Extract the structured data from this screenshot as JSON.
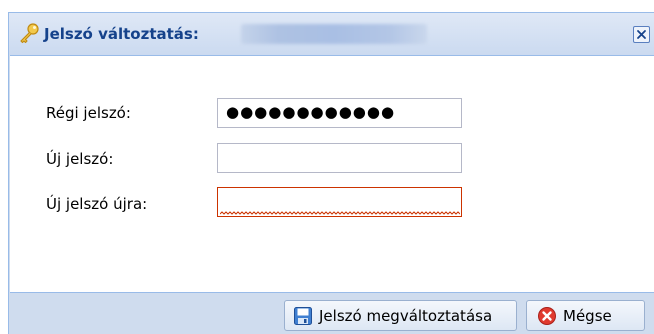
{
  "dialog": {
    "title": "Jelszó változtatás:",
    "icon": "key-icon",
    "close_icon": "close-icon"
  },
  "form": {
    "fields": [
      {
        "label": "Régi jelszó:",
        "value": "●●●●●●●●●●●●",
        "state": "filled"
      },
      {
        "label": "Új jelszó:",
        "value": "",
        "state": "empty"
      },
      {
        "label": "Új jelszó újra:",
        "value": "",
        "state": "invalid"
      }
    ],
    "invalid_color": "#cc3300"
  },
  "buttons": {
    "change_label": "Jelszó megváltoztatása",
    "change_icon": "save-disk-icon",
    "cancel_label": "Mégse",
    "cancel_icon": "cancel-icon"
  },
  "colors": {
    "title_text": "#15428b",
    "window_border": "#99bbe8",
    "frame_background": "#cfdcee"
  }
}
